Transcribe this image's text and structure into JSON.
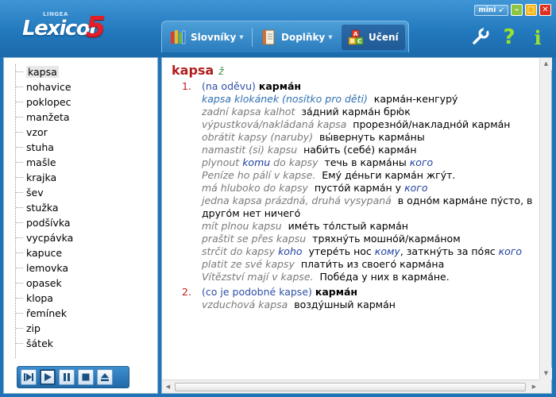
{
  "app": {
    "logo_small": "LINGEA",
    "logo_text": "Lexicon",
    "logo_number": "5",
    "mini_label": "mini"
  },
  "tabs": [
    {
      "label": "Slovníky",
      "icon": "books-icon"
    },
    {
      "label": "Doplňky",
      "icon": "book-icon"
    },
    {
      "label": "Učení",
      "icon": "abc-blocks-icon"
    }
  ],
  "tools": {
    "settings_icon": "wrench-icon",
    "help_label": "?",
    "info_label": "i"
  },
  "wordlist": [
    "kapsa",
    "nohavice",
    "poklopec",
    "manžeta",
    "vzor",
    "stuha",
    "mašle",
    "krajka",
    "šev",
    "stužka",
    "podšívka",
    "vycpávka",
    "kapuce",
    "lemovka",
    "opasek",
    "klopa",
    "řemínek",
    "zip",
    "šátek"
  ],
  "selected_word": "kapsa",
  "player": {
    "buttons": [
      "skip-next-icon",
      "play-icon",
      "pause-icon",
      "stop-icon",
      "eject-icon"
    ],
    "active": "play-icon"
  },
  "entry": {
    "headword": "kapsa",
    "gender": "ž",
    "sense1": {
      "num": "1.",
      "note": "(na oděvu)",
      "translation": "карма́н",
      "examples": [
        {
          "cz": "kapsa klokánek (nosítko pro děti)",
          "ru": "карма́н-кенгуру́",
          "style": "blue"
        },
        {
          "cz": "zadní kapsa kalhot",
          "ru": "за́дний карма́н брю́к"
        },
        {
          "cz": "výpustková/nakládaná kapsa",
          "ru": "прорезно́й/накладно́й карма́н"
        },
        {
          "cz": "obrátit kapsy (naruby)",
          "ru": "вы́вернуть карма́ны"
        },
        {
          "cz": "namastit (si) kapsu",
          "ru": "наби́ть (себе́) карма́н"
        }
      ],
      "ex6_cz1": "plynout",
      "ex6_cz2": "komu",
      "ex6_cz3": "do kapsy",
      "ex6_ru1": "течь в карма́ны",
      "ex6_ru2": "кого",
      "ex7_cz": "Peníze ho pálí v kapse.",
      "ex7_ru": "Ему́ де́ньги карма́н жгу́т.",
      "ex8_cz": "má hluboko do kapsy",
      "ex8_ru1": "пусто́й карма́н у",
      "ex8_ru2": "кого",
      "ex9_cz": "jedna kapsa prázdná, druhá vysypaná",
      "ex9_ru": "в одно́м карма́не пу́сто, в друго́м нет ничего́",
      "ex10_cz": "mít plnou kapsu",
      "ex10_ru": "име́ть то́лстый карма́н",
      "ex11_cz": "praštit se přes kapsu",
      "ex11_ru": "тряхну́ть мошно́й/карма́ном",
      "ex12_cz1": "strčit do kapsy",
      "ex12_cz2": "koho",
      "ex12_ru1": "утере́ть нос",
      "ex12_ru2": "кому",
      "ex12_ru3": ", заткну́ть за по́яс",
      "ex12_ru4": "кого",
      "ex13_cz": "platit ze své kapsy",
      "ex13_ru": "плати́ть из своего́ карма́на",
      "ex14_cz": "Vítězství mají v kapse.",
      "ex14_ru": "Побе́да у них в карма́не."
    },
    "sense2": {
      "num": "2.",
      "note": "(co je podobné kapse)",
      "translation": "карма́н",
      "ex_cz": "vzduchová kapsa",
      "ex_ru": "возду́шный карма́н"
    }
  },
  "colors": {
    "header": "#2279bd",
    "headword": "#b21e1e",
    "sense_number": "#c21a1a",
    "gender": "#3c8a3c",
    "note": "#2e4fa8",
    "example": "#7a7a7a"
  }
}
